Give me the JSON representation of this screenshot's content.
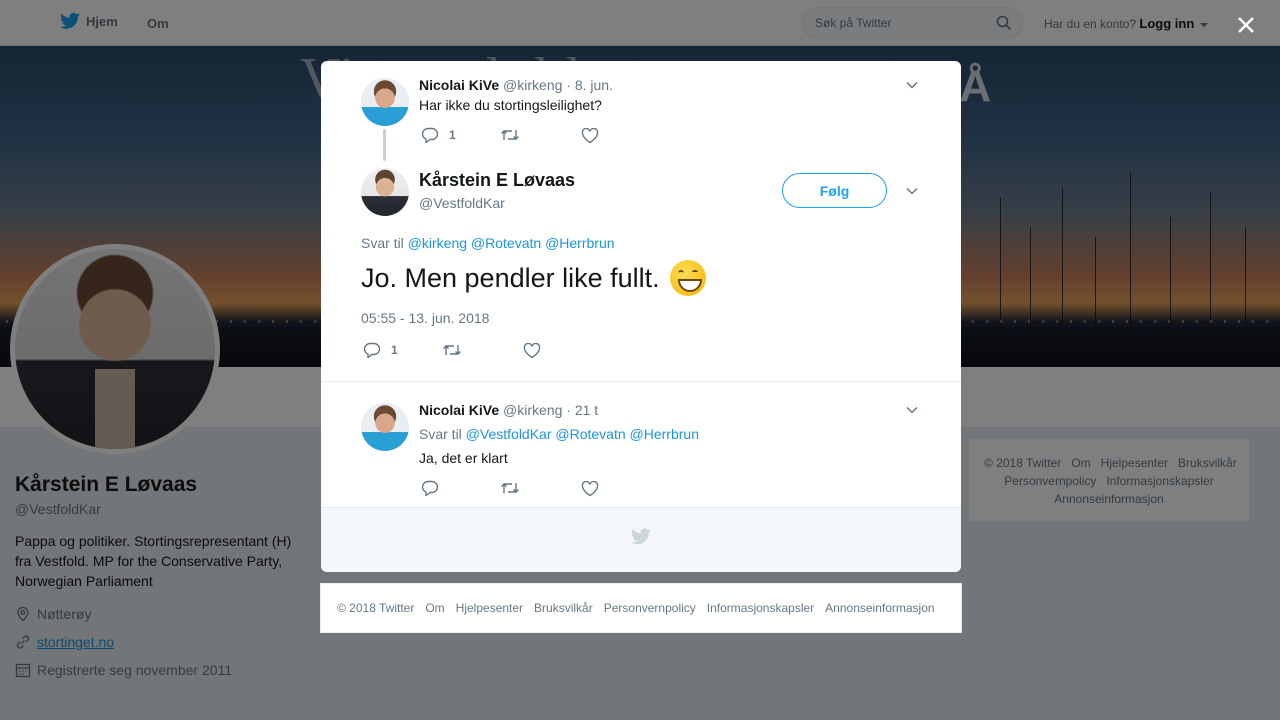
{
  "nav": {
    "home_label": "Hjem",
    "about_label": "Om",
    "search_placeholder": "Søk på Twitter",
    "account_question": "Har du en konto?",
    "login_label": "Logg inn"
  },
  "banner": {
    "text_left": "Vi t   ø  t l   d l",
    "text_right": "PÅ"
  },
  "profile": {
    "name": "Kårstein E Løvaas",
    "handle": "@VestfoldKar",
    "bio": "Pappa og politiker. Stortingsrepresentant (H) fra Vestfold. MP for the Conservative Party, Norwegian Parliament",
    "location": "Nøtterøy",
    "website": "stortinget.no",
    "joined": "Registrerte seg november 2011"
  },
  "right_footer": {
    "links": [
      "© 2018 Twitter",
      "Om",
      "Hjelpesenter",
      "Bruksvilkår",
      "Personvernpolicy",
      "Informasjonskapsler",
      "Annonseinformasjon"
    ]
  },
  "modal": {
    "parent_tweet": {
      "name": "Nicolai KiVe",
      "handle": "@kirkeng",
      "time": "· 8. jun.",
      "text": "Har ikke du stortingsleilighet?",
      "reply_count": "1"
    },
    "main_tweet": {
      "name": "Kårstein E Løvaas",
      "handle": "@VestfoldKar",
      "follow_label": "Følg",
      "reply_to_prefix": "Svar til",
      "mentions": [
        "@kirkeng",
        "@Rotevatn",
        "@Herrbrun"
      ],
      "text": "Jo. Men pendler like fullt.",
      "timestamp": "05:55 - 13. jun. 2018",
      "reply_count": "1"
    },
    "reply_tweet": {
      "name": "Nicolai KiVe",
      "handle": "@kirkeng",
      "time": "· 21 t",
      "reply_to_prefix": "Svar til",
      "mentions": [
        "@VestfoldKar",
        "@Rotevatn",
        "@Herrbrun"
      ],
      "text": "Ja, det er klart"
    }
  },
  "page_footer": {
    "links": [
      "© 2018 Twitter",
      "Om",
      "Hjelpesenter",
      "Bruksvilkår",
      "Personvernpolicy",
      "Informasjonskapsler",
      "Annonseinformasjon"
    ]
  },
  "colors": {
    "accent": "#1da1f2",
    "link": "#1b95e0",
    "muted": "#657786",
    "overlay": "rgba(0,0,0,0.5)"
  },
  "icons": [
    "twitter-bird-icon",
    "search-icon",
    "close-icon",
    "chevron-down-icon",
    "reply-icon",
    "retweet-icon",
    "like-icon",
    "location-icon",
    "link-icon",
    "calendar-icon"
  ]
}
